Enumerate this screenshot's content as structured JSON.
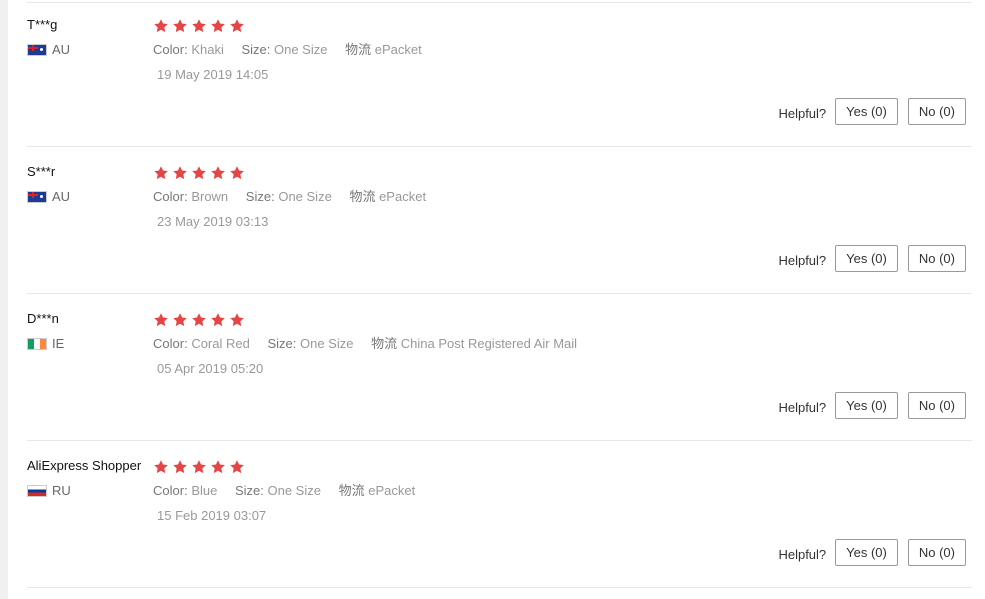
{
  "reviews": [
    {
      "user": "T***g",
      "country": "AU",
      "flag_icon": "au-flag-icon",
      "rating": 5,
      "attributes": [
        {
          "key": "Color:",
          "value": "Khaki"
        },
        {
          "key": "Size:",
          "value": "One Size"
        },
        {
          "key": "物流",
          "value": "ePacket"
        }
      ],
      "date": "19 May 2019 14:05",
      "helpful_label": "Helpful?",
      "yes_label": "Yes (0)",
      "no_label": "No (0)"
    },
    {
      "user": "S***r",
      "country": "AU",
      "flag_icon": "au-flag-icon",
      "rating": 5,
      "attributes": [
        {
          "key": "Color:",
          "value": "Brown"
        },
        {
          "key": "Size:",
          "value": "One Size"
        },
        {
          "key": "物流",
          "value": "ePacket"
        }
      ],
      "date": "23 May 2019 03:13",
      "helpful_label": "Helpful?",
      "yes_label": "Yes (0)",
      "no_label": "No (0)"
    },
    {
      "user": "D***n",
      "country": "IE",
      "flag_icon": "ie-flag-icon",
      "rating": 5,
      "attributes": [
        {
          "key": "Color:",
          "value": "Coral Red"
        },
        {
          "key": "Size:",
          "value": "One Size"
        },
        {
          "key": "物流",
          "value": "China Post Registered Air Mail"
        }
      ],
      "date": "05 Apr 2019 05:20",
      "helpful_label": "Helpful?",
      "yes_label": "Yes (0)",
      "no_label": "No (0)"
    },
    {
      "user": "AliExpress Shopper",
      "country": "RU",
      "flag_icon": "ru-flag-icon",
      "rating": 5,
      "attributes": [
        {
          "key": "Color:",
          "value": "Blue"
        },
        {
          "key": "Size:",
          "value": "One Size"
        },
        {
          "key": "物流",
          "value": "ePacket"
        }
      ],
      "date": "15 Feb 2019 03:07",
      "helpful_label": "Helpful?",
      "yes_label": "Yes (0)",
      "no_label": "No (0)"
    }
  ],
  "colors": {
    "star": "#e64545",
    "border": "#e8e8e8",
    "muted_text": "#999999"
  }
}
